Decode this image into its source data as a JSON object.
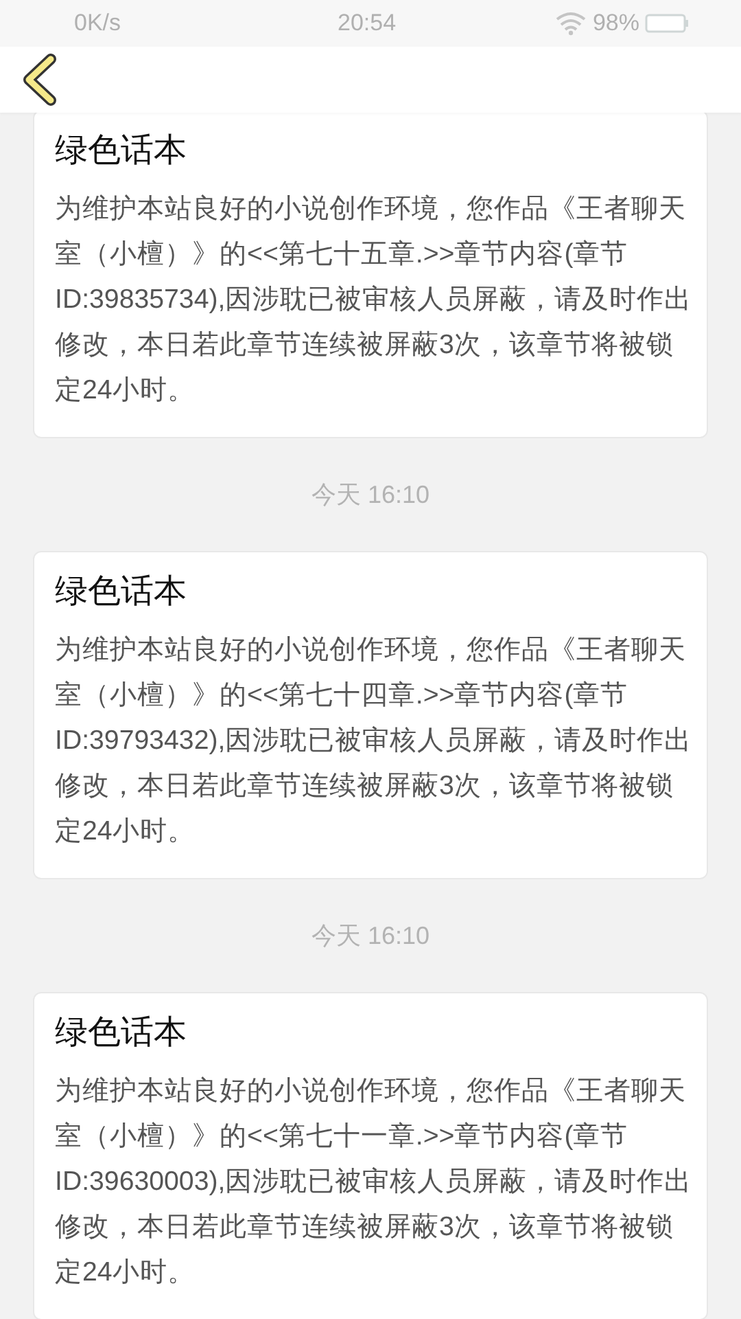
{
  "status_bar": {
    "speed": "0K/s",
    "time": "20:54",
    "battery": "98%"
  },
  "messages": [
    {
      "title": "绿色话本",
      "body": "为维护本站良好的小说创作环境，您作品《王者聊天室（小檀）》的<<第七十五章.>>章节内容(章节ID:39835734),因涉耽已被审核人员屏蔽，请及时作出修改，本日若此章节连续被屏蔽3次，该章节将被锁定24小时。"
    },
    {
      "time": "今天 16:10",
      "title": "绿色话本",
      "body": "为维护本站良好的小说创作环境，您作品《王者聊天室（小檀）》的<<第七十四章.>>章节内容(章节ID:39793432),因涉耽已被审核人员屏蔽，请及时作出修改，本日若此章节连续被屏蔽3次，该章节将被锁定24小时。"
    },
    {
      "time": "今天 16:10",
      "title": "绿色话本",
      "body": "为维护本站良好的小说创作环境，您作品《王者聊天室（小檀）》的<<第七十一章.>>章节内容(章节ID:39630003),因涉耽已被审核人员屏蔽，请及时作出修改，本日若此章节连续被屏蔽3次，该章节将被锁定24小时。"
    }
  ]
}
